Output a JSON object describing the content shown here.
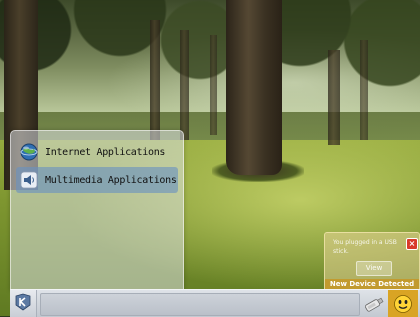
{
  "menu": {
    "items": [
      {
        "label": "Internet Applications",
        "icon": "globe-icon"
      },
      {
        "label": "Multimedia Applications",
        "icon": "speaker-icon"
      }
    ],
    "highlighted_item": "Multimedia Applications"
  },
  "notification": {
    "message": "You plugged in a USB stick.",
    "view_label": "View",
    "title": "New Device Detected"
  },
  "taskbar": {
    "start_icon": "kde-logo-icon",
    "tray_icons": [
      "usb-device-icon",
      "smiley-icon"
    ]
  },
  "colors": {
    "menu_highlight": "#6992c0",
    "notification_title": "#c69626",
    "notification_close": "#d93a2a",
    "tray_smiley_bg": "#d9a424"
  }
}
